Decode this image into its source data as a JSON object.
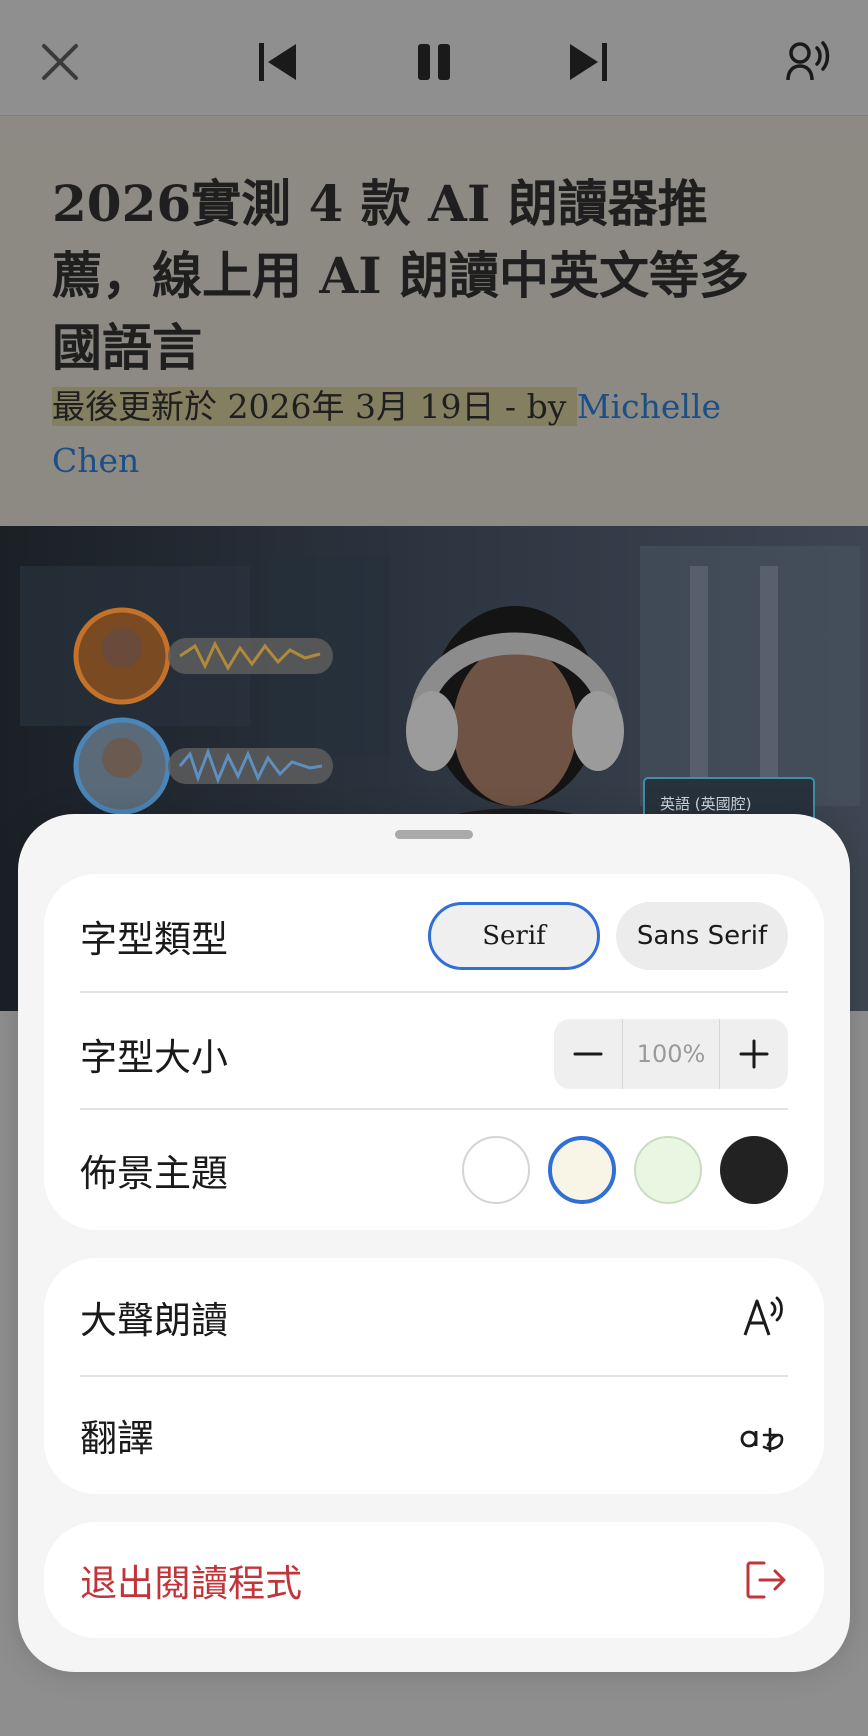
{
  "topbar": {
    "close_icon": "close-icon",
    "prev_icon": "skip-previous-icon",
    "pause_icon": "pause-icon",
    "next_icon": "skip-next-icon",
    "voice_icon": "voice-speaker-icon"
  },
  "article": {
    "title": "2026實測 4 款 AI 朗讀器推薦，線上用 AI 朗讀中英文等多國語言",
    "meta_prefix": "最後更新於 2026年 3月 19日 - by ",
    "author": "Michelle Chen"
  },
  "hero": {
    "badge_text": "英語 (英國腔)"
  },
  "sheet": {
    "font_type": {
      "label": "字型類型",
      "options": [
        "Serif",
        "Sans Serif"
      ],
      "selected": "Serif"
    },
    "font_size": {
      "label": "字型大小",
      "value": "100%",
      "decrease_icon": "minus-icon",
      "increase_icon": "plus-icon"
    },
    "theme": {
      "label": "佈景主題",
      "colors": [
        "#ffffff",
        "#f8f4e6",
        "#e9f6e1",
        "#222222"
      ],
      "selected_index": 1
    },
    "read_aloud": {
      "label": "大聲朗讀",
      "icon": "read-aloud-icon"
    },
    "translate": {
      "label": "翻譯",
      "icon": "translate-icon"
    },
    "exit": {
      "label": "退出閱讀程式",
      "icon": "exit-icon",
      "color": "#c0343a"
    },
    "accent": "#2f6fd6"
  }
}
